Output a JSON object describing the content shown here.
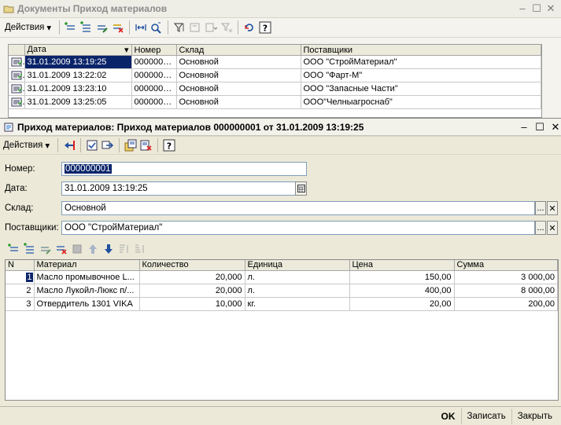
{
  "back_window": {
    "title": "Документы Приход материалов",
    "actions_menu": "Действия",
    "columns": [
      "Дата",
      "Номер",
      "Склад",
      "Поставщики"
    ],
    "rows": [
      {
        "date": "31.01.2009 13:19:25",
        "number": "0000000...",
        "warehouse": "Основной",
        "supplier": "ООО \"СтройМатериал\""
      },
      {
        "date": "31.01.2009 13:22:02",
        "number": "0000000...",
        "warehouse": "Основной",
        "supplier": "ООО \"Фарт-М\""
      },
      {
        "date": "31.01.2009 13:23:10",
        "number": "0000000...",
        "warehouse": "Основной",
        "supplier": "ООО \"Запасные Части\""
      },
      {
        "date": "31.01.2009 13:25:05",
        "number": "0000000...",
        "warehouse": "Основной",
        "supplier": "ООО\"Челныагроснаб\""
      }
    ]
  },
  "front_window": {
    "title": "Приход материалов: Приход материалов 000000001 от 31.01.2009 13:19:25",
    "actions_menu": "Действия",
    "fields": {
      "number_label": "Номер:",
      "number_value": "000000001",
      "date_label": "Дата:",
      "date_value": "31.01.2009 13:19:25",
      "warehouse_label": "Склад:",
      "warehouse_value": "Основной",
      "supplier_label": "Поставщики:",
      "supplier_value": "ООО \"СтройМатериал\""
    },
    "table": {
      "columns": [
        "N",
        "Материал",
        "Количество",
        "Единица",
        "Цена",
        "Сумма"
      ],
      "rows": [
        {
          "n": "1",
          "material": "Масло промывочное L...",
          "qty": "20,000",
          "unit": "л.",
          "price": "150,00",
          "sum": "3 000,00"
        },
        {
          "n": "2",
          "material": "Масло Лукойл-Люкс п/...",
          "qty": "20,000",
          "unit": "л.",
          "price": "400,00",
          "sum": "8 000,00"
        },
        {
          "n": "3",
          "material": "Отвердитель 1301 VIKA",
          "qty": "10,000",
          "unit": "кг.",
          "price": "20,00",
          "sum": "200,00"
        }
      ]
    },
    "buttons": {
      "ok": "OK",
      "save": "Записать",
      "close": "Закрыть"
    }
  },
  "window_controls": {
    "minimize": "–",
    "maximize": "☐",
    "close": "✕"
  },
  "field_button": {
    "select": "...",
    "clear": "✕"
  }
}
